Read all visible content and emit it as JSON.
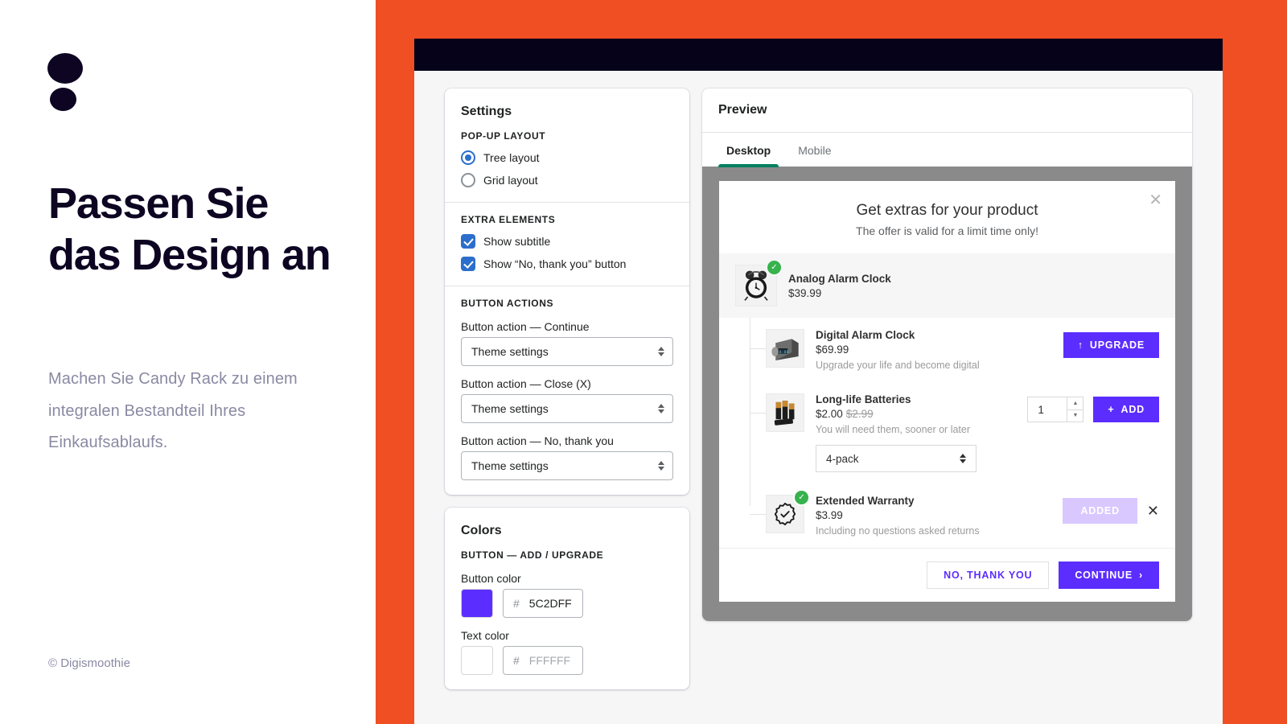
{
  "promo": {
    "logo_icon": "two-dots-logo",
    "title": "Passen Sie das Design an",
    "subtitle": "Machen Sie Candy Rack zu einem integralen Bestandteil Ihres Einkaufsablaufs.",
    "footer": "© Digismoothie"
  },
  "colors": {
    "brand_orange": "#F04E23",
    "dark_navy": "#05021A",
    "accent_blue": "#2C6ECB",
    "tab_green": "#008060",
    "popup_purple": "#5C2DFF",
    "added_lavender": "#D9C8FF",
    "check_green": "#37B24D"
  },
  "settings": {
    "title": "Settings",
    "popup_layout": {
      "label": "POP-UP LAYOUT",
      "options": [
        {
          "label": "Tree layout",
          "selected": true
        },
        {
          "label": "Grid layout",
          "selected": false
        }
      ]
    },
    "extra_elements": {
      "label": "EXTRA ELEMENTS",
      "options": [
        {
          "label": "Show subtitle",
          "checked": true
        },
        {
          "label": "Show “No, thank you” button",
          "checked": true
        }
      ]
    },
    "button_actions": {
      "label": "BUTTON ACTIONS",
      "fields": [
        {
          "label": "Button action — Continue",
          "value": "Theme settings"
        },
        {
          "label": "Button action — Close (X)",
          "value": "Theme settings"
        },
        {
          "label": "Button action — No, thank you",
          "value": "Theme settings"
        }
      ]
    }
  },
  "colors_card": {
    "title": "Colors",
    "section_label": "BUTTON — ADD / UPGRADE",
    "fields": [
      {
        "label": "Button color",
        "hash": "#",
        "value": "5C2DFF",
        "swatch": "#5C2DFF",
        "muted": false
      },
      {
        "label": "Text color",
        "hash": "#",
        "value": "FFFFFF",
        "swatch": "#FFFFFF",
        "muted": true
      }
    ]
  },
  "preview": {
    "title": "Preview",
    "tabs": [
      {
        "label": "Desktop",
        "active": true
      },
      {
        "label": "Mobile",
        "active": false
      }
    ]
  },
  "popup": {
    "title": "Get extras for your product",
    "subtitle": "The offer is valid for a limit time only!",
    "close_icon": "close-icon",
    "parent_product": {
      "name": "Analog Alarm Clock",
      "price": "$39.99",
      "image_icon": "analog-alarm-clock-thumbnail",
      "selected_badge": "check-badge-icon"
    },
    "children": [
      {
        "name": "Digital Alarm Clock",
        "price": "$69.99",
        "compare_at": "",
        "description": "Upgrade your life and become digital",
        "image_icon": "digital-alarm-clock-thumbnail",
        "action": {
          "type": "upgrade",
          "label": "UPGRADE",
          "icon": "arrow-up-icon"
        }
      },
      {
        "name": "Long-life Batteries",
        "price": "$2.00",
        "compare_at": "$2.99",
        "description": "You will need them, sooner or later",
        "image_icon": "batteries-thumbnail",
        "variant": {
          "value": "4-pack"
        },
        "quantity": "1",
        "action": {
          "type": "add",
          "label": "ADD",
          "icon": "plus-icon"
        }
      },
      {
        "name": "Extended Warranty",
        "price": "$3.99",
        "compare_at": "",
        "description": "Including no questions asked returns",
        "image_icon": "warranty-seal-icon",
        "selected_badge": "check-badge-icon",
        "action": {
          "type": "added",
          "label": "ADDED",
          "remove_icon": "remove-x-icon"
        }
      }
    ],
    "footer": {
      "secondary": "NO, THANK YOU",
      "primary": "CONTINUE",
      "primary_icon": "chevron-right-icon"
    }
  }
}
